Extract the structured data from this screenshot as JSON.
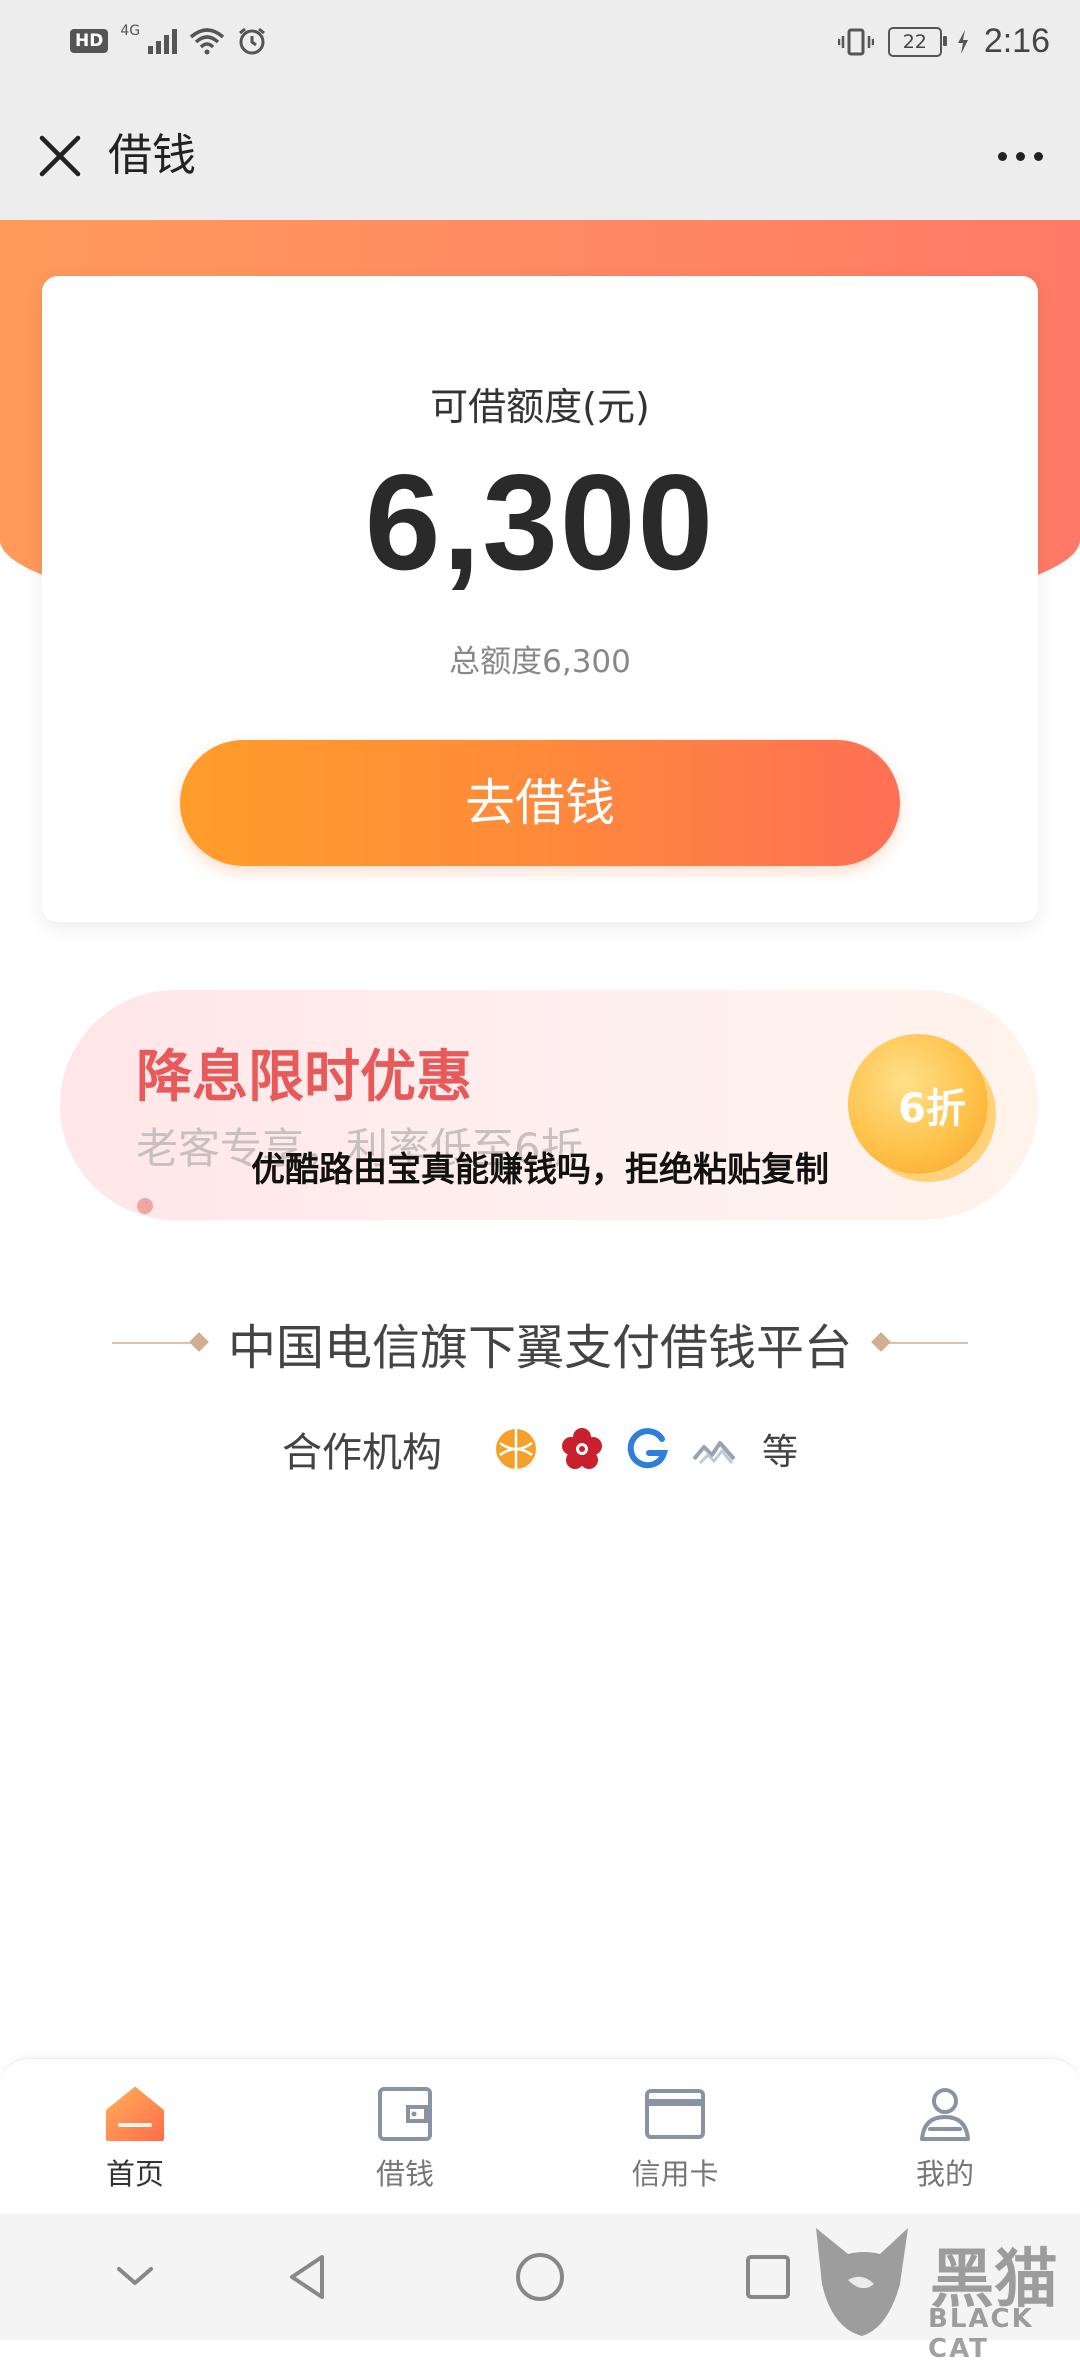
{
  "status_bar": {
    "hd": "HD",
    "network": "4G",
    "battery": "22",
    "time": "2:16"
  },
  "header": {
    "title": "借钱",
    "close_icon": "close-icon",
    "more_icon": "more-icon"
  },
  "quota_card": {
    "label": "可借额度(元)",
    "amount": "6,300",
    "total": "总额度6,300",
    "button": "去借钱"
  },
  "promo": {
    "title": "降息限时优惠",
    "subtitle": "老客专享，利率低至6折",
    "badge": "6折"
  },
  "overlay": "优酷路由宝真能赚钱吗，拒绝粘贴复制",
  "platform": {
    "text": "中国电信旗下翼支付借钱平台",
    "partners_label": "合作机构",
    "partners_suffix": "等",
    "partner_icons": [
      "partner-logo-orange-icon",
      "partner-logo-red-flower-icon",
      "partner-logo-blue-g-icon",
      "partner-logo-grey-wave-icon"
    ]
  },
  "tabs": [
    {
      "label": "首页",
      "icon": "home-icon"
    },
    {
      "label": "借钱",
      "icon": "wallet-icon"
    },
    {
      "label": "信用卡",
      "icon": "credit-card-icon"
    },
    {
      "label": "我的",
      "icon": "profile-icon"
    }
  ],
  "watermark": {
    "text": "黑猫",
    "sub": "BLACK CAT"
  },
  "colors": {
    "accent": "#ff8a3a",
    "hero": "#ff8a62",
    "promo_text": "#e85a5a",
    "active_tab": "#ff7f55"
  }
}
